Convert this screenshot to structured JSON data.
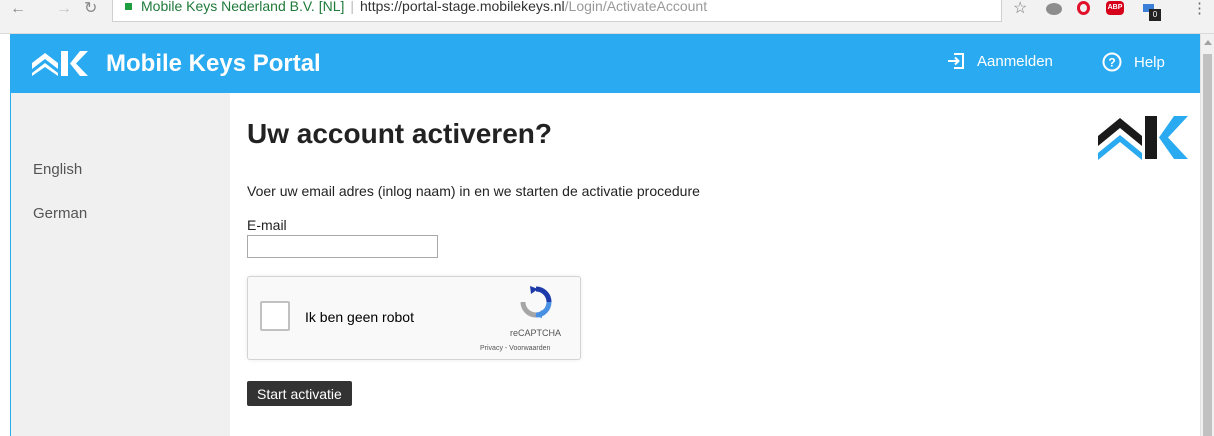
{
  "browser": {
    "site_name": "Mobile Keys Nederland B.V. [NL]",
    "url_host": "https://portal-stage.mobilekeys.nl",
    "url_path": "/Login/ActivateAccount",
    "abp_label": "ABP",
    "ext_badge": "0"
  },
  "header": {
    "title": "Mobile Keys Portal",
    "signin_label": "Aanmelden",
    "help_label": "Help",
    "color": "#2aaaf0"
  },
  "sidebar": {
    "languages": [
      "English",
      "German"
    ]
  },
  "main": {
    "title": "Uw account activeren?",
    "intro": "Voer uw email adres (inlog naam) in en we starten de activatie procedure",
    "email_label": "E-mail",
    "email_value": "",
    "captcha": {
      "label": "Ik ben geen robot",
      "brand": "reCAPTCHA",
      "links": "Privacy - Voorwaarden"
    },
    "submit_label": "Start activatie"
  }
}
